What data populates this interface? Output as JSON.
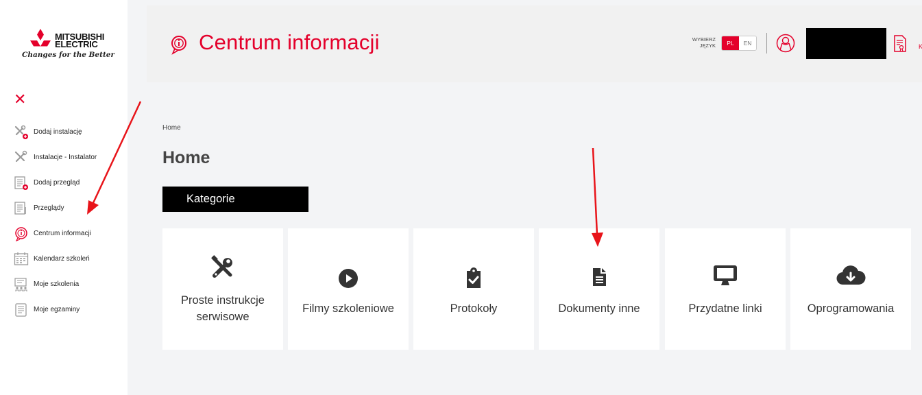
{
  "logo": {
    "brand_line1": "MITSUBISHI",
    "brand_line2": "ELECTRIC",
    "tagline": "Changes for the Better"
  },
  "sidebar": {
    "close_icon": "close-icon",
    "items": [
      {
        "label": "Dodaj instalację",
        "icon": "tools-add-icon"
      },
      {
        "label": "Instalacje - Instalator",
        "icon": "tools-icon"
      },
      {
        "label": "Dodaj przegląd",
        "icon": "inspection-add-icon"
      },
      {
        "label": "Przeglądy",
        "icon": "inspection-icon"
      },
      {
        "label": "Centrum informacji",
        "icon": "info-icon"
      },
      {
        "label": "Kalendarz szkoleń",
        "icon": "calendar-icon"
      },
      {
        "label": "Moje szkolenia",
        "icon": "training-icon"
      },
      {
        "label": "Moje egzaminy",
        "icon": "exam-icon"
      }
    ]
  },
  "header": {
    "title": "Centrum informacji",
    "language_label_line1": "WYBIERZ",
    "language_label_line2": "JĘZYK",
    "languages": [
      "PL",
      "EN"
    ],
    "selected_language": "PL",
    "cut_off_text": "K"
  },
  "breadcrumb": "Home",
  "page_title": "Home",
  "section_title": "Kategorie",
  "categories": [
    {
      "label": "Proste instrukcje serwisowe",
      "icon": "tools-icon"
    },
    {
      "label": "Filmy szkoleniowe",
      "icon": "play-icon"
    },
    {
      "label": "Protokoły",
      "icon": "clipboard-check-icon"
    },
    {
      "label": "Dokumenty inne",
      "icon": "document-icon"
    },
    {
      "label": "Przydatne linki",
      "icon": "monitor-icon"
    },
    {
      "label": "Oprogramowania",
      "icon": "cloud-download-icon"
    }
  ],
  "colors": {
    "accent": "#e4002b",
    "annotation_arrow": "#e8141a",
    "background": "#f3f4f6",
    "header_bg": "#f1f1f1"
  }
}
